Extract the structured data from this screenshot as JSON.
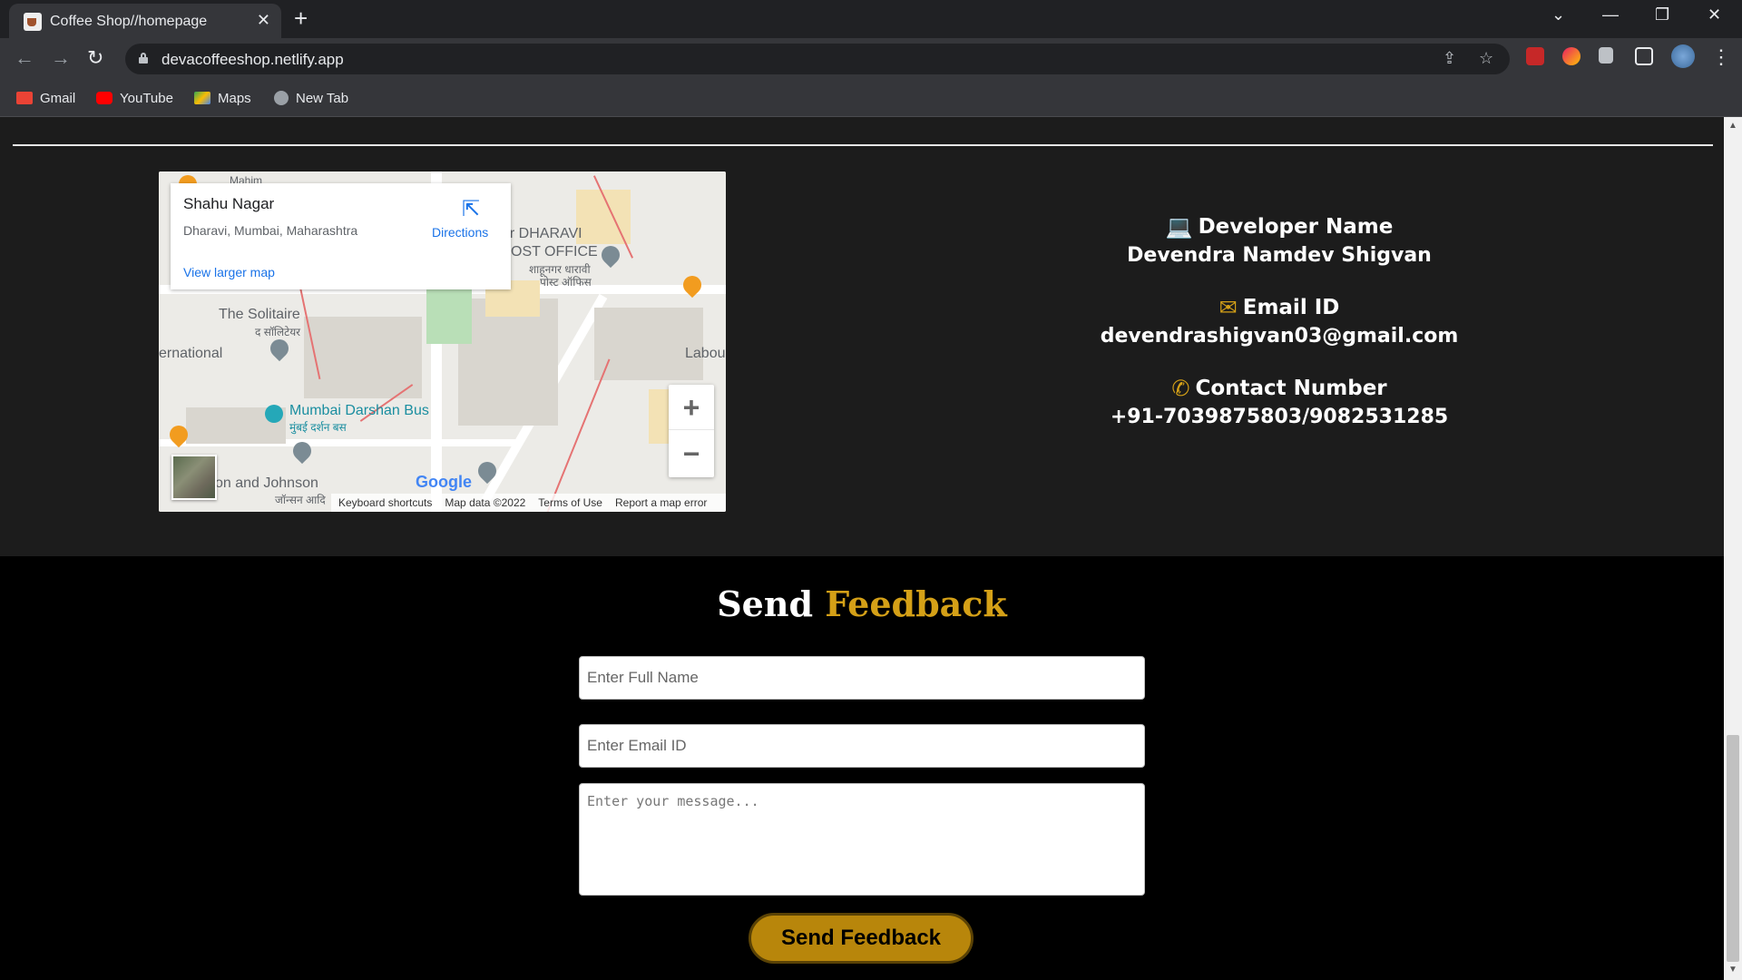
{
  "browser": {
    "tab_title": "Coffee Shop//homepage",
    "tab_close": "✕",
    "new_tab": "+",
    "url": "devacoffeeshop.netlify.app",
    "window_controls": {
      "dropdown": "⌄",
      "minimize": "—",
      "restore": "❐",
      "close": "✕"
    },
    "nav": {
      "back": "←",
      "forward": "→",
      "reload": "↻"
    },
    "omnibox_icons": {
      "share": "⇪",
      "bookmark": "☆"
    },
    "menu": "⋮"
  },
  "bookmarks": [
    {
      "label": "Gmail",
      "icon": "gmail-icon",
      "color": "#ea4335"
    },
    {
      "label": "YouTube",
      "icon": "youtube-icon",
      "color": "#ff0000"
    },
    {
      "label": "Maps",
      "icon": "maps-icon",
      "color": "#34a853"
    },
    {
      "label": "New Tab",
      "icon": "globe-icon",
      "color": "#9aa0a6"
    }
  ],
  "map": {
    "place_title": "Shahu Nagar",
    "place_address": "Dharavi, Mumbai, Maharashtra",
    "directions_label": "Directions",
    "larger_map_link": "View larger map",
    "labels": {
      "dharavi_post": "ar DHARAVI",
      "post_office": "OST OFFICE",
      "post_hindi_1": "शाहूनगर धारावी",
      "post_hindi_2": "पोस्ट ऑफिस",
      "solitaire": "The Solitaire",
      "solitaire_hindi": "द सॉलिटेयर",
      "international": "ernational",
      "labou": "Labou",
      "darshan_bus": "Mumbai Darshan Bus",
      "darshan_hindi": "मुंबई दर्शन बस",
      "johnson": "on and Johnson",
      "johnson_hindi": "जॉन्सन आदि",
      "mahim": "Mahim"
    },
    "zoom_in": "+",
    "zoom_out": "−",
    "google_logo": "Google",
    "footer": [
      "Keyboard shortcuts",
      "Map data ©2022",
      "Terms of Use",
      "Report a map error"
    ]
  },
  "developer": {
    "name_label": "Developer Name",
    "name_value": "Devendra Namdev Shigvan",
    "email_label": "Email ID",
    "email_value": "devendrashigvan03@gmail.com",
    "contact_label": "Contact Number",
    "contact_value": "+91-7039875803/9082531285",
    "accent": "#d4a017"
  },
  "feedback": {
    "title_part1": "Send",
    "title_part2": "Feedback",
    "name_placeholder": "Enter Full Name",
    "email_placeholder": "Enter Email ID",
    "message_placeholder": "Enter your message...",
    "submit_label": "Send Feedback",
    "button_color": "#b8860b"
  }
}
